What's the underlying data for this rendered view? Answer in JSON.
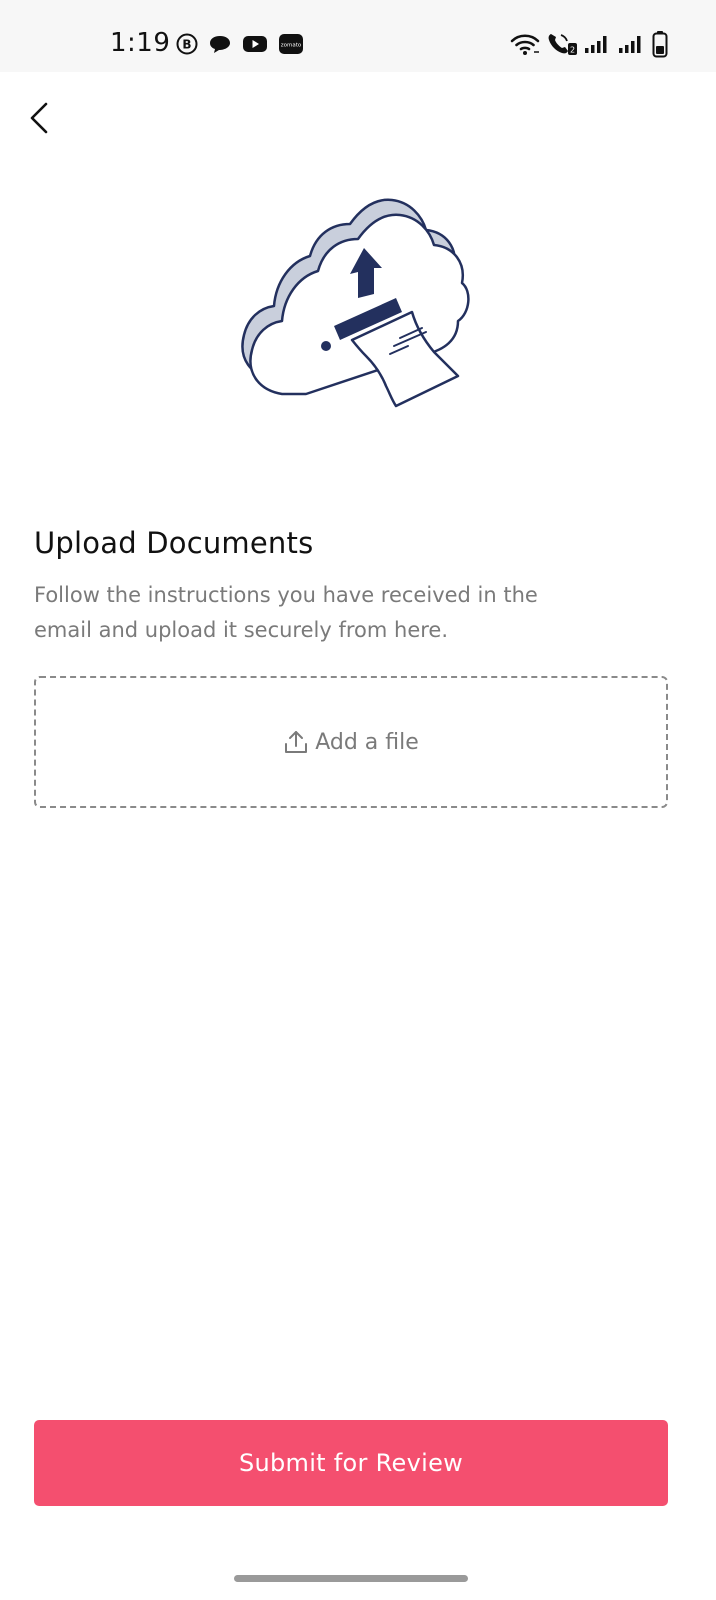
{
  "status_bar": {
    "time": "1:19",
    "left_icons": [
      "b-circle-icon",
      "chat-bubble-icon",
      "youtube-icon",
      "zomato-icon"
    ],
    "zomato_label": "zomato",
    "right_icons": [
      "wifi-icon",
      "volte-call-icon",
      "signal-icon",
      "signal-icon",
      "battery-icon"
    ]
  },
  "header": {
    "back_icon": "chevron-left-icon"
  },
  "illustration": {
    "icon": "cloud-upload-document-icon"
  },
  "content": {
    "title": "Upload Documents",
    "subtitle": "Follow the instructions you have received in the email and upload it securely from here."
  },
  "upload": {
    "icon": "upload-icon",
    "label": "Add a file"
  },
  "actions": {
    "submit_label": "Submit for Review"
  },
  "colors": {
    "primary": "#f44f6f",
    "illustration_stroke": "#23305e",
    "text_primary": "#111111",
    "text_secondary": "#7a7a7a"
  }
}
